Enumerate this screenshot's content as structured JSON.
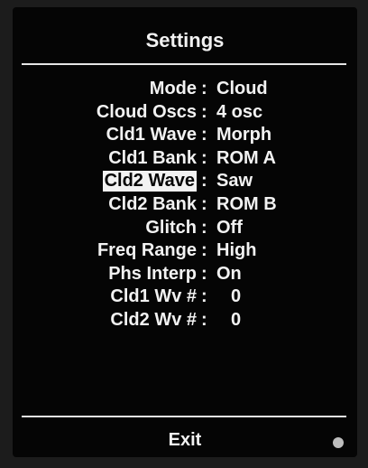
{
  "title": "Settings",
  "rows": [
    {
      "label": "Mode",
      "value": "Cloud"
    },
    {
      "label": "Cloud Oscs",
      "value": "4 osc"
    },
    {
      "label": "Cld1 Wave",
      "value": "Morph"
    },
    {
      "label": "Cld1 Bank",
      "value": "ROM A"
    },
    {
      "label": "Cld2 Wave",
      "value": "Saw",
      "selected": true
    },
    {
      "label": "Cld2 Bank",
      "value": "ROM B"
    },
    {
      "label": "Glitch",
      "value": "Off"
    },
    {
      "label": "Freq Range",
      "value": "High"
    },
    {
      "label": "Phs Interp",
      "value": "On"
    },
    {
      "label": "Cld1 Wv #",
      "value": "0"
    },
    {
      "label": "Cld2 Wv #",
      "value": "0"
    }
  ],
  "separator": ":",
  "exit_label": "Exit",
  "colors": {
    "screen_background": "#050505",
    "text": "#f2f2f2",
    "selection_background": "#f2f2f2",
    "selection_text": "#050505"
  },
  "icons": {
    "status_indicator": "led-dot-icon"
  }
}
